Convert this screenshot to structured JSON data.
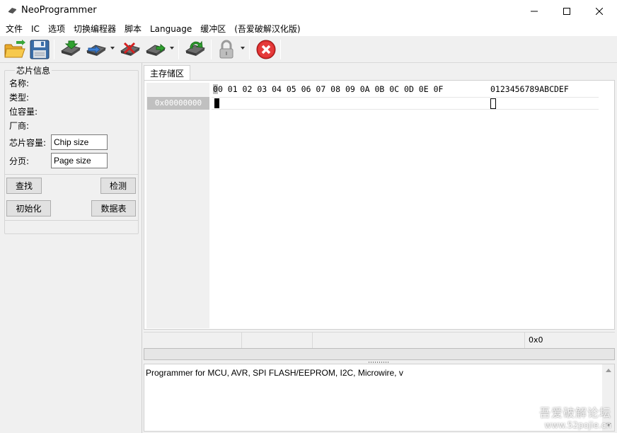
{
  "window": {
    "title": "NeoProgrammer",
    "controls": {
      "minimize": "minimize-icon",
      "maximize": "maximize-icon",
      "close": "close-icon"
    }
  },
  "menu": {
    "items": [
      {
        "label": "文件"
      },
      {
        "label": "IC"
      },
      {
        "label": "选项"
      },
      {
        "label": "切换编程器"
      },
      {
        "label": "脚本"
      },
      {
        "label": "Language"
      },
      {
        "label": "缓冲区"
      },
      {
        "label": "(吾爱破解汉化版)"
      }
    ]
  },
  "toolbar": {
    "buttons": [
      {
        "icon": "open-folder-icon"
      },
      {
        "icon": "save-floppy-icon"
      },
      {
        "icon": "read-chip-icon"
      },
      {
        "icon": "write-chip-icon"
      },
      {
        "icon": "erase-chip-icon"
      },
      {
        "icon": "verify-chip-icon"
      },
      {
        "icon": "auto-program-icon"
      },
      {
        "icon": "lock-icon"
      },
      {
        "icon": "stop-icon"
      }
    ]
  },
  "chip_info": {
    "legend": "芯片信息",
    "name_label": "名称:",
    "type_label": "类型:",
    "bitsize_label": "位容量:",
    "vendor_label": "厂商:",
    "chip_size_label": "芯片容量:",
    "chip_size_value": "Chip size",
    "page_label": "分页:",
    "page_value": "Page size"
  },
  "actions": {
    "find": "查找",
    "detect": "检测",
    "init": "初始化",
    "datasheet": "数据表"
  },
  "editor": {
    "tab_label": "主存储区",
    "header_first": "0",
    "header_rest": "0 01 02 03 04 05 06 07 08 09 0A 0B 0C 0D 0E 0F",
    "ascii_header": "0123456789ABCDEF",
    "row_address": "0x00000000"
  },
  "status": {
    "offset": "0x0"
  },
  "log": {
    "text": "Programmer for MCU, AVR, SPI FLASH/EEPROM, I2C, Microwire,  v"
  },
  "watermark": {
    "line1": "吾爱破解论坛",
    "line2": "www.52pojie.cn"
  }
}
